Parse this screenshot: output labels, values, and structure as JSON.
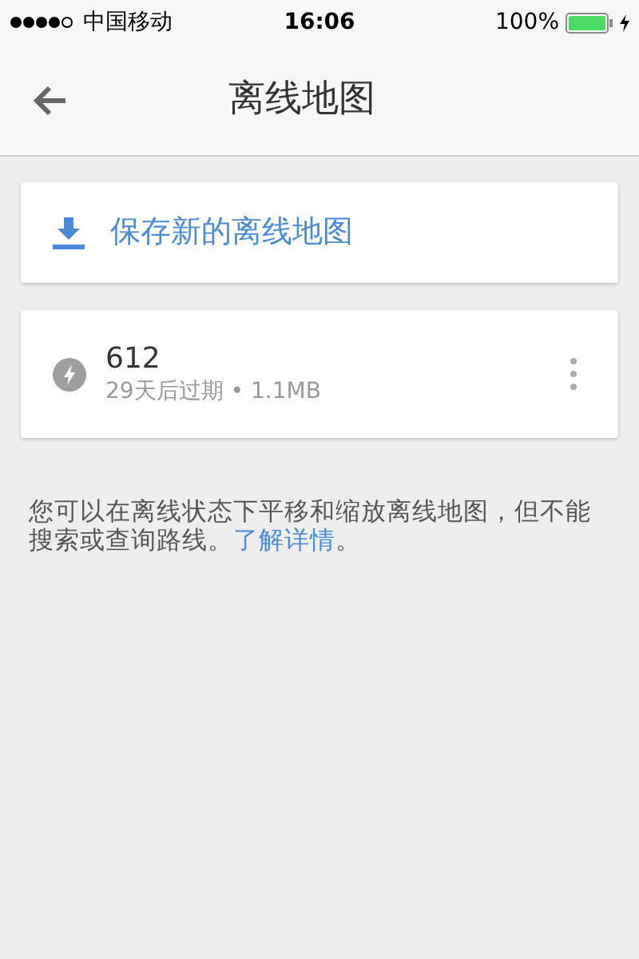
{
  "status_bar": {
    "carrier": "中国移动",
    "time": "16:06",
    "battery": "100%"
  },
  "header": {
    "title": "离线地图"
  },
  "save_card": {
    "label": "保存新的离线地图"
  },
  "maps": [
    {
      "name": "612",
      "details": "29天后过期 • 1.1MB"
    }
  ],
  "info": {
    "text": "您可以在离线状态下平移和缩放离线地图，但不能搜索或查询路线。",
    "link": "了解详情",
    "end": "。"
  }
}
